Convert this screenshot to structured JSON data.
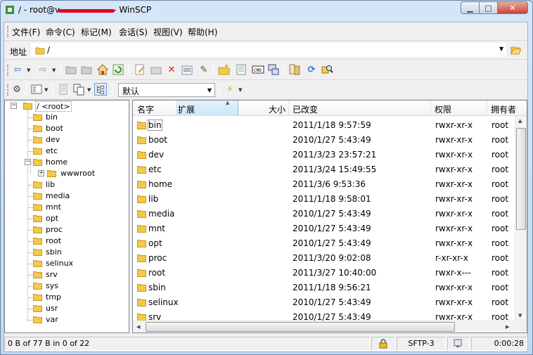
{
  "window": {
    "title_prefix": "/ - root@v",
    "title_suffix": "- WinSCP",
    "min_glyph": "▁",
    "max_glyph": "□",
    "close_glyph": "✕"
  },
  "menu": [
    "文件(F)",
    "命令(C)",
    "标记(M)",
    "会话(S)",
    "视图(V)",
    "帮助(H)"
  ],
  "address": {
    "label": "地址",
    "value": "/"
  },
  "toolbar2": {
    "profile_value": "默认"
  },
  "tree": {
    "root": "/ <root>",
    "items": [
      "bin",
      "boot",
      "dev",
      "etc",
      "home",
      "wwwroot",
      "lib",
      "media",
      "mnt",
      "opt",
      "proc",
      "root",
      "sbin",
      "selinux",
      "srv",
      "sys",
      "tmp",
      "usr",
      "var"
    ]
  },
  "list": {
    "columns": [
      "名字",
      "扩展",
      "大小",
      "已改变",
      "权限",
      "拥有者"
    ],
    "rows": [
      {
        "name": "bin",
        "changed": "2011/1/18 9:57:59",
        "perm": "rwxr-xr-x",
        "owner": "root"
      },
      {
        "name": "boot",
        "changed": "2010/1/27 5:43:49",
        "perm": "rwxr-xr-x",
        "owner": "root"
      },
      {
        "name": "dev",
        "changed": "2011/3/23 23:57:21",
        "perm": "rwxr-xr-x",
        "owner": "root"
      },
      {
        "name": "etc",
        "changed": "2011/3/24 15:49:55",
        "perm": "rwxr-xr-x",
        "owner": "root"
      },
      {
        "name": "home",
        "changed": "2011/3/6 9:53:36",
        "perm": "rwxr-xr-x",
        "owner": "root"
      },
      {
        "name": "lib",
        "changed": "2011/1/18 9:58:01",
        "perm": "rwxr-xr-x",
        "owner": "root"
      },
      {
        "name": "media",
        "changed": "2010/1/27 5:43:49",
        "perm": "rwxr-xr-x",
        "owner": "root"
      },
      {
        "name": "mnt",
        "changed": "2010/1/27 5:43:49",
        "perm": "rwxr-xr-x",
        "owner": "root"
      },
      {
        "name": "opt",
        "changed": "2010/1/27 5:43:49",
        "perm": "rwxr-xr-x",
        "owner": "root"
      },
      {
        "name": "proc",
        "changed": "2011/3/20 9:02:08",
        "perm": "r-xr-xr-x",
        "owner": "root"
      },
      {
        "name": "root",
        "changed": "2011/3/27 10:40:00",
        "perm": "rwxr-x---",
        "owner": "root"
      },
      {
        "name": "sbin",
        "changed": "2011/1/18 9:56:21",
        "perm": "rwxr-xr-x",
        "owner": "root"
      },
      {
        "name": "selinux",
        "changed": "2010/1/27 5:43:49",
        "perm": "rwxr-xr-x",
        "owner": "root"
      },
      {
        "name": "srv",
        "changed": "2010/1/27 5:43:49",
        "perm": "rwxr-xr-x",
        "owner": "root"
      }
    ]
  },
  "status": {
    "selection": "0 B of 77 B in 0 of 22",
    "protocol": "SFTP-3",
    "elapsed": "0:00:28"
  },
  "colors": {
    "folder": "#f2c94c",
    "accent": "#cde6f7"
  }
}
